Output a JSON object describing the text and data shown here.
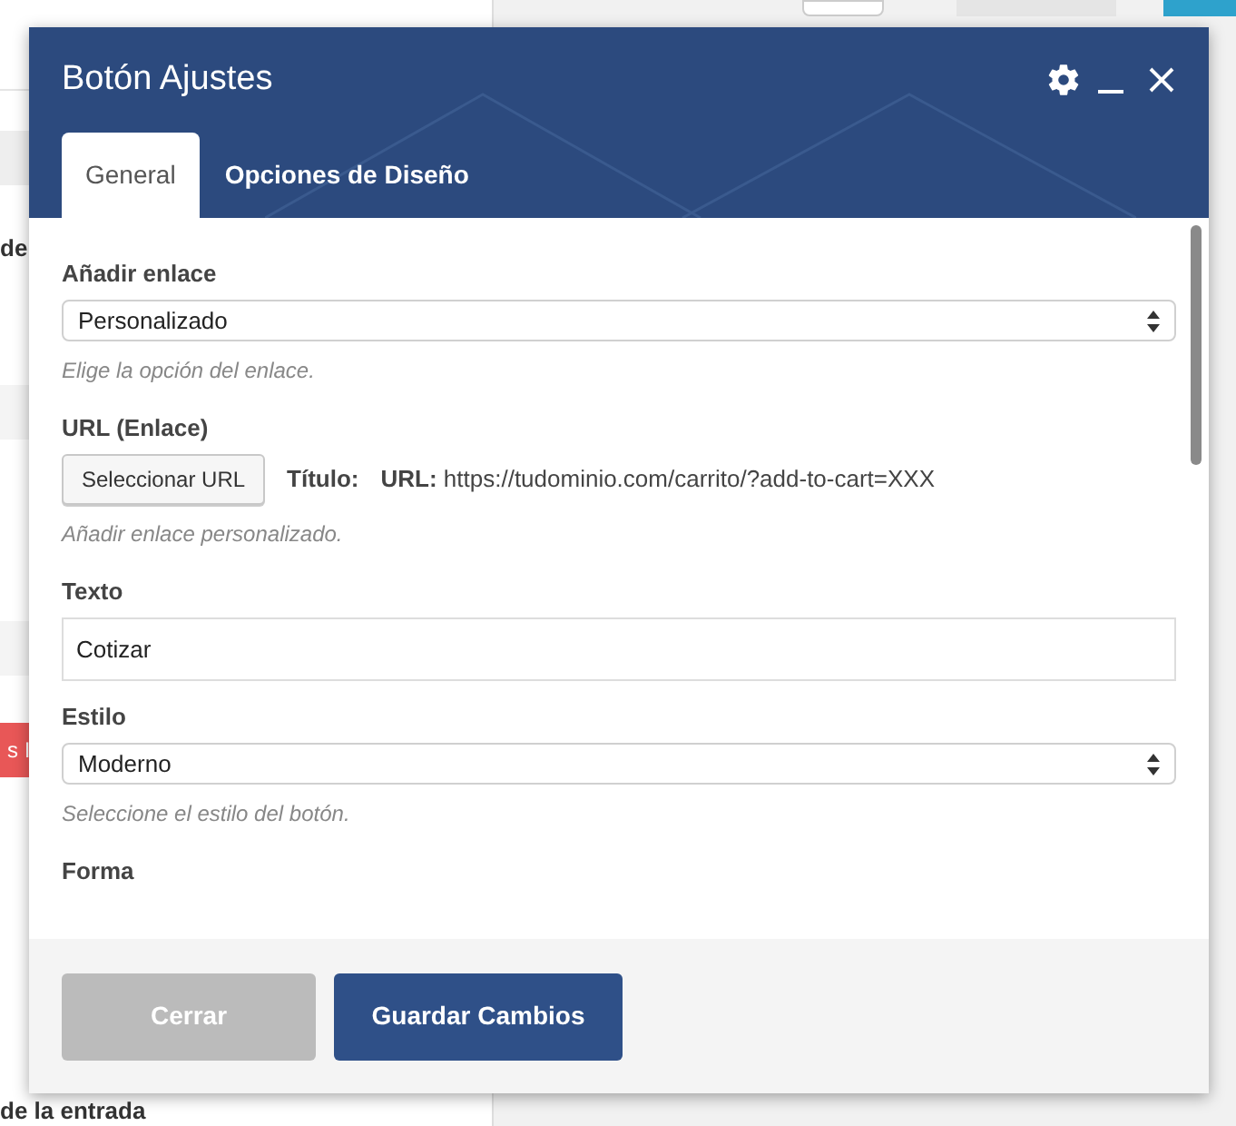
{
  "background": {
    "label_top": "de",
    "button": "s I",
    "label_bottom": "de la entrada"
  },
  "dialog": {
    "title": "Botón Ajustes",
    "tabs": [
      {
        "label": "General",
        "selected": true
      },
      {
        "label": "Opciones de Diseño",
        "selected": false
      }
    ],
    "fields": [
      {
        "kind": "select",
        "label": "Añadir enlace",
        "value": "Personalizado",
        "help": "Elige la opción del enlace."
      },
      {
        "kind": "url",
        "label": "URL (Enlace)",
        "button": "Seleccionar URL",
        "title_label": "Título:",
        "url_label": "URL:",
        "url": "https://tudominio.com/carrito/?add-to-cart=XXX",
        "help": "Añadir enlace personalizado."
      },
      {
        "kind": "text",
        "label": "Texto",
        "value": "Cotizar"
      },
      {
        "kind": "select",
        "label": "Estilo",
        "value": "Moderno",
        "help": "Seleccione el estilo del botón."
      },
      {
        "kind": "heading",
        "label": "Forma"
      }
    ],
    "buttons": [
      {
        "label": "Cerrar",
        "kind": "secondary"
      },
      {
        "label": "Guardar Cambios",
        "kind": "primary"
      }
    ]
  }
}
